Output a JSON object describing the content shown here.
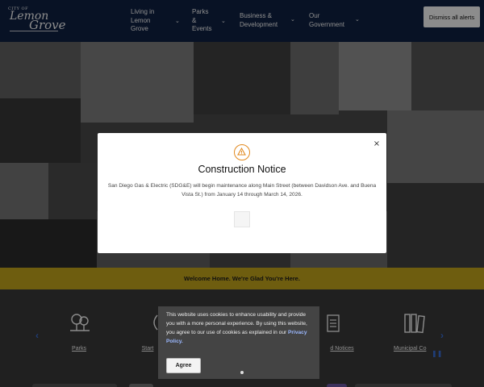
{
  "header": {
    "logo": {
      "city_text": "CITY OF",
      "lemon_text": "Lemon",
      "grove_text": "Grove"
    },
    "nav": [
      {
        "label": "Living in\nLemon\nGrove",
        "icon": "chevron-down-icon"
      },
      {
        "label": "Parks\n&\nEvents",
        "icon": "chevron-down-icon"
      },
      {
        "label": "Business &\nDevelopment",
        "icon": "chevron-down-icon"
      },
      {
        "label": "Our\nGovernment",
        "icon": "chevron-down-icon"
      }
    ],
    "dismiss_label": "Dismiss all alerts"
  },
  "banner": {
    "text": "Welcome Home. We're Glad You're Here."
  },
  "quick_links": [
    {
      "label": "Parks",
      "icon": "park-trees-icon"
    },
    {
      "label": "Start",
      "icon": "start-icon"
    },
    {
      "label": "d Notices",
      "icon": "news-icon"
    },
    {
      "label": "Municipal Co",
      "icon": "books-icon"
    }
  ],
  "modal": {
    "icon": "warning-icon",
    "close_symbol": "×",
    "title": "Construction Notice",
    "body": "San Diego Gas & Electric (SDG&E) will begin maintenance along Main Street (between Davidson Ave. and Buena Vista St.) from January 14 through March 14, 2026."
  },
  "cookie": {
    "text": "This website uses cookies to enhance usability and provide you with a more personal experience. By using this website, you agree to our use of cookies as explained in our",
    "link_text": "Privacy Policy.",
    "agree_label": "Agree"
  },
  "colors": {
    "header_bg": "#0f2144",
    "banner_bg": "#c9a91c",
    "accent_blue": "#3a70d9",
    "warning_orange": "#e28a1f"
  }
}
